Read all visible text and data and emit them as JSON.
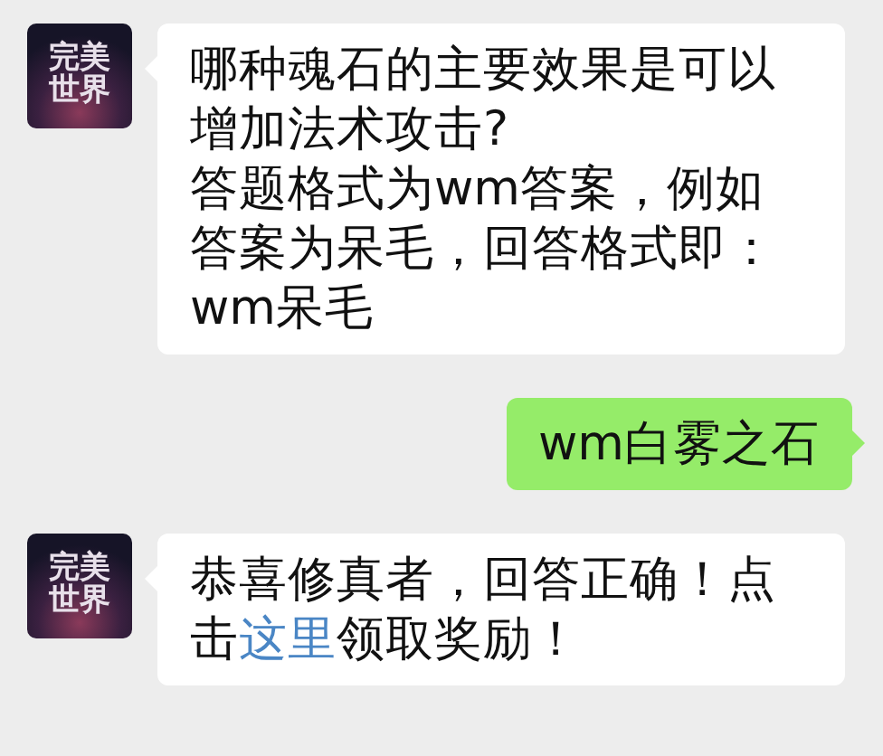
{
  "messages": [
    {
      "outgoing": false,
      "avatar": {
        "logo": "完美世界"
      },
      "paragraphs": [
        [
          {
            "kind": "text",
            "text": "哪种魂石的主要效果是可以增加法术攻击?"
          }
        ],
        [
          {
            "kind": "text",
            "text": "答题格式为wm答案，例如答案为呆毛，回答格式即：wm呆毛"
          }
        ]
      ]
    },
    {
      "outgoing": true,
      "paragraphs": [
        [
          {
            "kind": "text",
            "text": "wm白雾之石"
          }
        ]
      ]
    },
    {
      "outgoing": false,
      "avatar": {
        "logo": "完美世界"
      },
      "paragraphs": [
        [
          {
            "kind": "text",
            "text": "恭喜修真者，回答正确！点击"
          },
          {
            "kind": "link",
            "text": "这里"
          },
          {
            "kind": "text",
            "text": "领取奖励！"
          }
        ]
      ]
    }
  ]
}
